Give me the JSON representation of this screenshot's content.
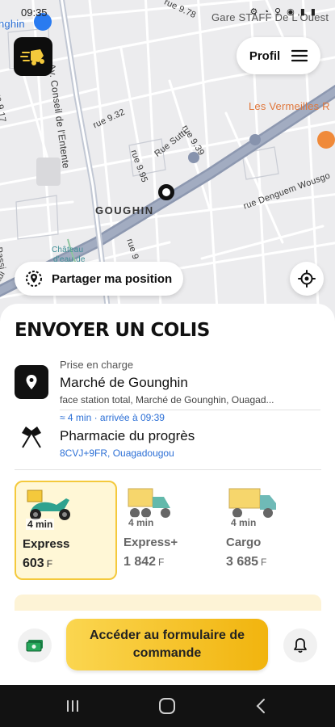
{
  "status_bar": {
    "time": "09:35",
    "icons": "⚙ ◔ ⚲ ◉ ▮ ▮"
  },
  "map": {
    "labels": {
      "top_left": "nghin",
      "entente": "Av. Conseil de l'Entente",
      "rue932": "rue 9.32",
      "rue939": "rue 9.39",
      "rue995": "rue 9.95",
      "sutti": "Rue Sutti",
      "goughin": "GOUGHIN",
      "vermeilles": "Les Vermeilles R",
      "gare": "Gare STAFF De L'Ouest",
      "denguem": "rue Denguem Wousgo",
      "chateau1": "Château",
      "chateau2": "d'eau de",
      "rue978": "rue 9.78",
      "rue917": "rue 9.17",
      "rueGo": "rue 9 Go",
      "passi": "Passi",
      "adi": "adi"
    }
  },
  "header": {
    "profile_label": "Profil"
  },
  "share_position_label": "Partager ma position",
  "sheet": {
    "title": "ENVOYER UN COLIS",
    "pickup": {
      "caption": "Prise en charge",
      "name": "Marché de Gounghin",
      "address": "face station total, Marché de Gounghin, Ouagad..."
    },
    "eta": "≈ 4 min · arrivée à 09:39",
    "dropoff": {
      "name": "Pharmacie du progrès",
      "code": "8CVJ+9FR, Ouagadougou"
    },
    "vehicles": [
      {
        "time": "4 min",
        "name": "Express",
        "price": "603",
        "currency": "F"
      },
      {
        "time": "4 min",
        "name": "Express+",
        "price": "1 842",
        "currency": "F"
      },
      {
        "time": "4 min",
        "name": "Cargo",
        "price": "3 685",
        "currency": "F"
      }
    ],
    "order_button": "Accéder au formulaire de commande"
  },
  "colors": {
    "accent": "#f4c93c",
    "link": "#2b6fd6",
    "dark": "#111111"
  }
}
